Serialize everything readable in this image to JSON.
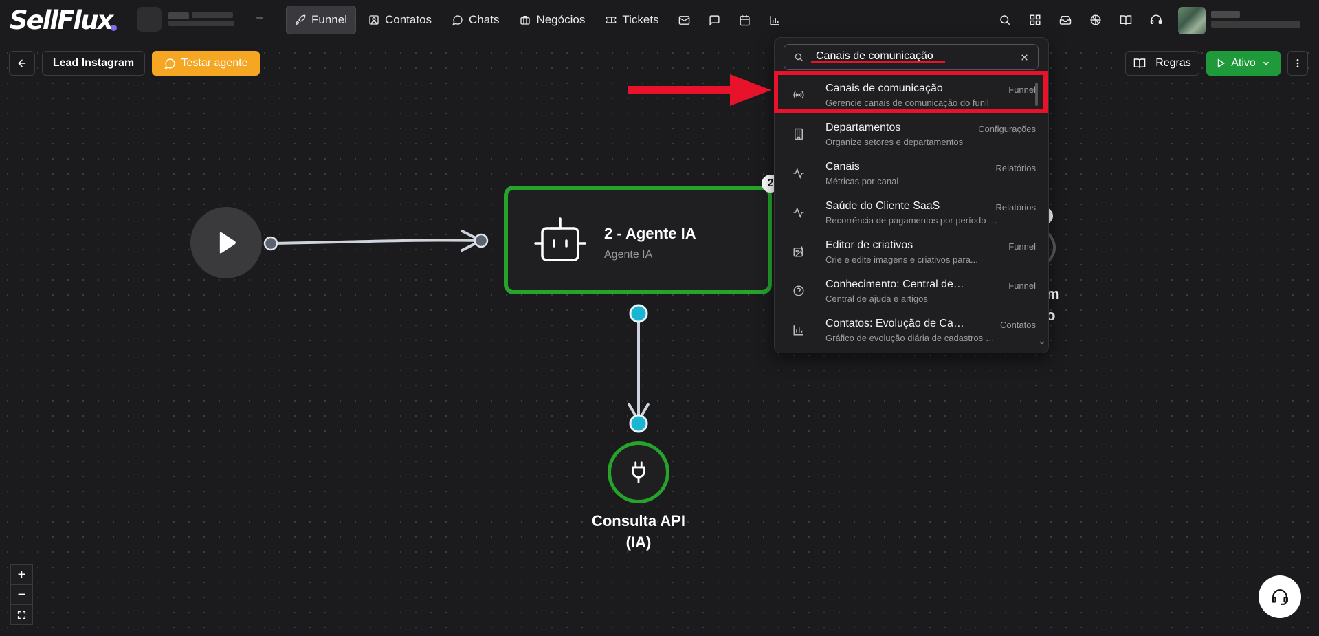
{
  "brand": {
    "name": "SellFlux"
  },
  "nav": {
    "items": [
      {
        "label": "Funnel",
        "icon": "rocket-icon",
        "active": true
      },
      {
        "label": "Contatos",
        "icon": "contact-icon"
      },
      {
        "label": "Chats",
        "icon": "chat-icon"
      },
      {
        "label": "Negócios",
        "icon": "briefcase-icon"
      },
      {
        "label": "Tickets",
        "icon": "ticket-icon"
      }
    ],
    "icon_buttons": [
      "mail-icon",
      "message-square-icon",
      "calendar-icon",
      "bar-chart-icon"
    ],
    "right_icons": [
      "search-icon",
      "apps-grid-icon",
      "inbox-icon",
      "brain-icon",
      "book-icon",
      "headset-icon"
    ]
  },
  "toolbar": {
    "back_icon": "arrow-left-icon",
    "flow_name": "Lead Instagram",
    "test_button": "Testar agente",
    "rules_button": "Regras",
    "status_button": "Ativo"
  },
  "flow": {
    "agent_node": {
      "title": "2 - Agente IA",
      "subtitle": "Agente IA",
      "badge": "2"
    },
    "api_node": {
      "label_line1": "Consulta API",
      "label_line2": "(IA)"
    },
    "partial_node": {
      "text_line1": "m",
      "text_line2": "o"
    }
  },
  "zoom_controls": {
    "zoom_in": "+",
    "zoom_out": "−",
    "fit": "⛶"
  },
  "search": {
    "query": "Canais de comunicação",
    "results": [
      {
        "title": "Canais de comunicação",
        "subtitle": "Gerencie canais de comunicação do funil",
        "category": "Funnel",
        "icon": "broadcast-icon"
      },
      {
        "title": "Departamentos",
        "subtitle": "Organize setores e departamentos",
        "category": "Configurações",
        "icon": "building-icon"
      },
      {
        "title": "Canais",
        "subtitle": "Métricas por canal",
        "category": "Relatórios",
        "icon": "activity-icon"
      },
      {
        "title": "Saúde do Cliente SaaS",
        "subtitle": "Recorrência de pagamentos por período co...",
        "category": "Relatórios",
        "icon": "activity-icon"
      },
      {
        "title": "Editor de criativos",
        "subtitle": "Crie e edite imagens e criativos para...",
        "category": "Funnel",
        "icon": "image-edit-icon"
      },
      {
        "title": "Conhecimento: Central de Ajuda",
        "subtitle": "Central de ajuda e artigos",
        "category": "Funnel",
        "icon": "help-circle-icon"
      },
      {
        "title": "Contatos: Evolução de Cadastr...",
        "subtitle": "Gráfico de evolução diária de cadastros de...",
        "category": "Contatos",
        "icon": "bar-chart-icon"
      }
    ]
  },
  "colors": {
    "canvas_bg": "#1b1b1d",
    "node_border": "#25a32b",
    "handle": "#1bb5d4",
    "highlight": "#e8132a",
    "test_button": "#f5a623",
    "status_button": "#1f9a3a"
  }
}
